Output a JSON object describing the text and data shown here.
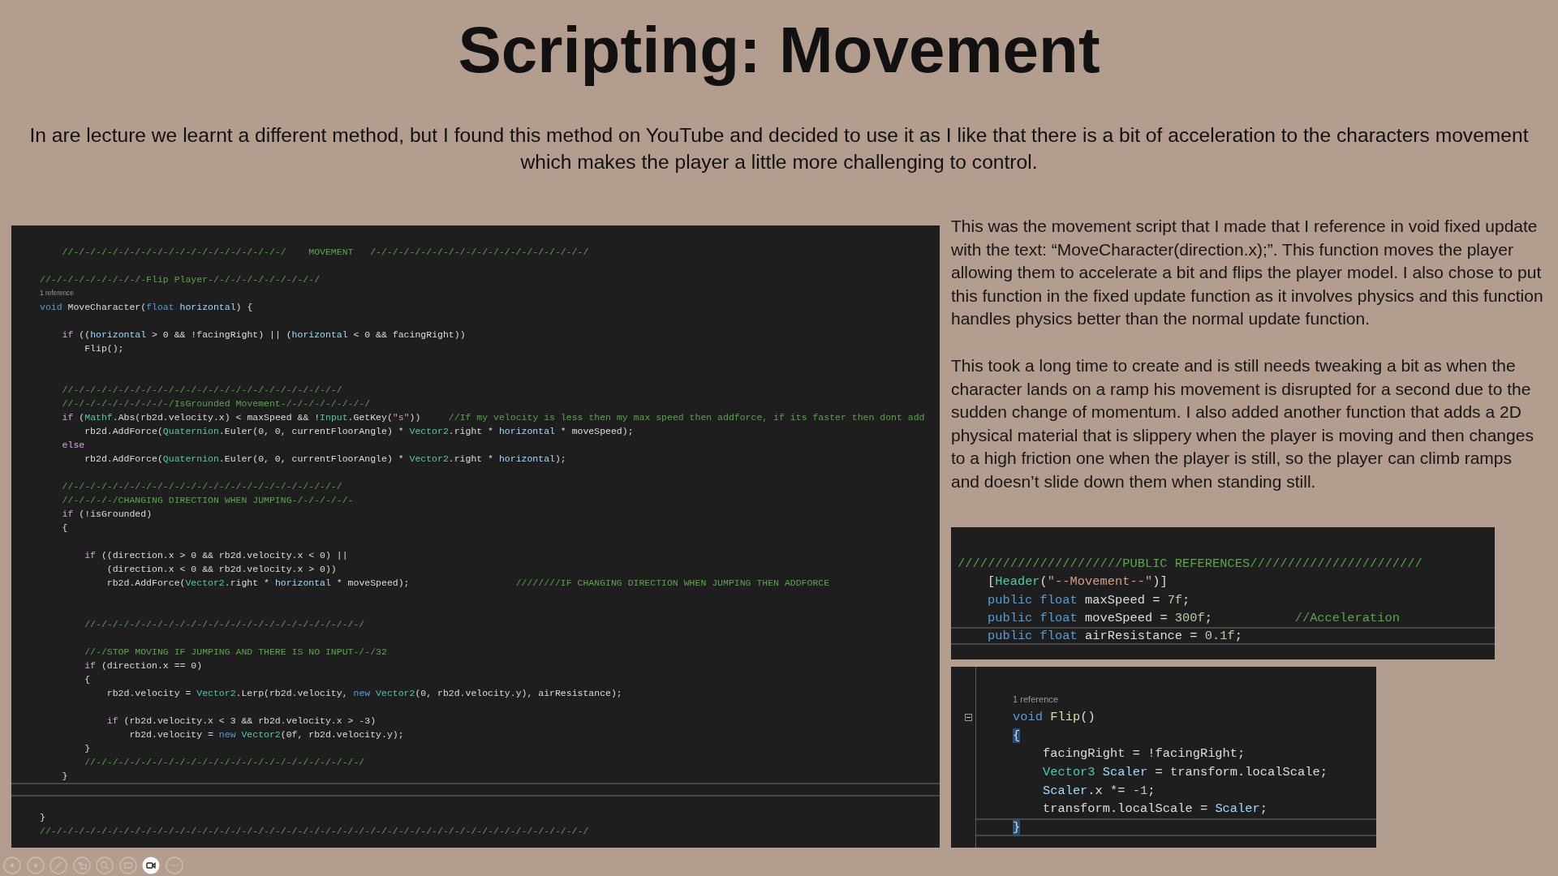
{
  "slide": {
    "title": "Scripting: Movement",
    "intro": "In are lecture we learnt a different method, but I found this method on YouTube and decided to use it as I like that there is a bit of acceleration to the characters movement which makes the player a little more challenging to control."
  },
  "code_screenshots": [
    {
      "lines": [
        {
          "kind": "code",
          "segments": [
            {
              "text": "    //-/-/-/-/-/-/-/-/-/-/-/-/-/-/-/-/-/-/-/    MOVEMENT   /-/-/-/-/-/-/-/-/-/-/-/-/-/-/-/-/-/-/-/",
              "kind": "comment"
            }
          ]
        },
        {
          "kind": "blank"
        },
        {
          "kind": "code",
          "segments": [
            {
              "text": "//-/-/-/-/-/-/-/-/-Flip Player-/-/-/-/-/-/-/-/-/-/",
              "kind": "comment"
            }
          ]
        },
        {
          "kind": "lens",
          "text": "1 reference"
        },
        {
          "kind": "code",
          "segments": [
            {
              "text": "void",
              "kind": "keyword"
            },
            {
              "text": " MoveCharacter(",
              "kind": "plain"
            },
            {
              "text": "float",
              "kind": "keyword"
            },
            {
              "text": " horizontal",
              "kind": "param"
            },
            {
              "text": ") {",
              "kind": "plain"
            }
          ]
        },
        {
          "kind": "blank"
        },
        {
          "kind": "code",
          "segments": [
            {
              "text": "    if",
              "kind": "control"
            },
            {
              "text": " ((",
              "kind": "plain"
            },
            {
              "text": "horizontal",
              "kind": "param"
            },
            {
              "text": " > 0 && !facingRight) || (",
              "kind": "plain"
            },
            {
              "text": "horizontal",
              "kind": "param"
            },
            {
              "text": " < 0 && facingRight))",
              "kind": "plain"
            }
          ]
        },
        {
          "kind": "code",
          "segments": [
            {
              "text": "        Flip();",
              "kind": "plain"
            }
          ]
        },
        {
          "kind": "blank"
        },
        {
          "kind": "blank"
        },
        {
          "kind": "code",
          "segments": [
            {
              "text": "    //-/-/-/-/-/-/-/-/-/-/-/-/-/-/-/-/-/-/-/-/-/-/-/-/",
              "kind": "comment"
            }
          ]
        },
        {
          "kind": "code",
          "segments": [
            {
              "text": "    //-/-/-/-/-/-/-/-/-/IsGrounded Movement-/-/-/-/-/-/-/-/",
              "kind": "comment"
            }
          ]
        },
        {
          "kind": "code",
          "segments": [
            {
              "text": "    if",
              "kind": "control"
            },
            {
              "text": " (",
              "kind": "plain"
            },
            {
              "text": "Mathf",
              "kind": "type"
            },
            {
              "text": ".Abs(rb2d.velocity.x) < maxSpeed && !",
              "kind": "plain"
            },
            {
              "text": "Input",
              "kind": "type"
            },
            {
              "text": ".GetKey(",
              "kind": "plain"
            },
            {
              "text": "\"s\"",
              "kind": "string"
            },
            {
              "text": "))     ",
              "kind": "plain"
            },
            {
              "text": "//If my velocity is less then my max speed then addforce, if its faster then dont add",
              "kind": "comment"
            }
          ]
        },
        {
          "kind": "code",
          "segments": [
            {
              "text": "        rb2d.AddForce(",
              "kind": "plain"
            },
            {
              "text": "Quaternion",
              "kind": "type"
            },
            {
              "text": ".Euler(0, 0, currentFloorAngle) * ",
              "kind": "plain"
            },
            {
              "text": "Vector2",
              "kind": "type"
            },
            {
              "text": ".right * ",
              "kind": "plain"
            },
            {
              "text": "horizontal",
              "kind": "param"
            },
            {
              "text": " * moveSpeed);",
              "kind": "plain"
            }
          ]
        },
        {
          "kind": "code",
          "segments": [
            {
              "text": "    else",
              "kind": "control"
            }
          ]
        },
        {
          "kind": "code",
          "segments": [
            {
              "text": "        rb2d.AddForce(",
              "kind": "plain"
            },
            {
              "text": "Quaternion",
              "kind": "type"
            },
            {
              "text": ".Euler(0, 0, currentFloorAngle) * ",
              "kind": "plain"
            },
            {
              "text": "Vector2",
              "kind": "type"
            },
            {
              "text": ".right * ",
              "kind": "plain"
            },
            {
              "text": "horizontal",
              "kind": "param"
            },
            {
              "text": ");",
              "kind": "plain"
            }
          ]
        },
        {
          "kind": "blank"
        },
        {
          "kind": "code",
          "segments": [
            {
              "text": "    //-/-/-/-/-/-/-/-/-/-/-/-/-/-/-/-/-/-/-/-/-/-/-/-/",
              "kind": "comment"
            }
          ]
        },
        {
          "kind": "code",
          "segments": [
            {
              "text": "    //-/-/-/-/CHANGING DIRECTION WHEN JUMPING-/-/-/-/-/-",
              "kind": "comment"
            }
          ]
        },
        {
          "kind": "code",
          "segments": [
            {
              "text": "    if",
              "kind": "control"
            },
            {
              "text": " (!isGrounded)",
              "kind": "plain"
            }
          ]
        },
        {
          "kind": "code",
          "segments": [
            {
              "text": "    {",
              "kind": "plain"
            }
          ]
        },
        {
          "kind": "blank"
        },
        {
          "kind": "code",
          "segments": [
            {
              "text": "        if",
              "kind": "control"
            },
            {
              "text": " ((direction.x > 0 && rb2d.velocity.x < 0) ||",
              "kind": "plain"
            }
          ]
        },
        {
          "kind": "code",
          "segments": [
            {
              "text": "            (direction.x < 0 && rb2d.velocity.x > 0))",
              "kind": "plain"
            }
          ]
        },
        {
          "kind": "code",
          "segments": [
            {
              "text": "            rb2d.AddForce(",
              "kind": "plain"
            },
            {
              "text": "Vector2",
              "kind": "type"
            },
            {
              "text": ".right * ",
              "kind": "plain"
            },
            {
              "text": "horizontal",
              "kind": "param"
            },
            {
              "text": " * moveSpeed);                   ",
              "kind": "plain"
            },
            {
              "text": "////////IF CHANGING DIRECTION WHEN JUMPING THEN ADDFORCE",
              "kind": "comment"
            }
          ]
        },
        {
          "kind": "blank"
        },
        {
          "kind": "blank"
        },
        {
          "kind": "code",
          "segments": [
            {
              "text": "        //-/-/-/-/-/-/-/-/-/-/-/-/-/-/-/-/-/-/-/-/-/-/-/-/",
              "kind": "comment"
            }
          ]
        },
        {
          "kind": "blank"
        },
        {
          "kind": "code",
          "segments": [
            {
              "text": "        //-/STOP MOVING IF JUMPING AND THERE IS NO INPUT-/-/32",
              "kind": "comment"
            }
          ]
        },
        {
          "kind": "code",
          "segments": [
            {
              "text": "        if",
              "kind": "control"
            },
            {
              "text": " (direction.x == 0)",
              "kind": "plain"
            }
          ]
        },
        {
          "kind": "code",
          "segments": [
            {
              "text": "        {",
              "kind": "plain"
            }
          ]
        },
        {
          "kind": "code",
          "segments": [
            {
              "text": "            rb2d.velocity = ",
              "kind": "plain"
            },
            {
              "text": "Vector2",
              "kind": "type"
            },
            {
              "text": ".Lerp(rb2d.velocity, ",
              "kind": "plain"
            },
            {
              "text": "new ",
              "kind": "keyword"
            },
            {
              "text": "Vector2",
              "kind": "type"
            },
            {
              "text": "(0, rb2d.velocity.y), airResistance);",
              "kind": "plain"
            }
          ]
        },
        {
          "kind": "blank"
        },
        {
          "kind": "code",
          "segments": [
            {
              "text": "            if",
              "kind": "control"
            },
            {
              "text": " (rb2d.velocity.x < 3 && rb2d.velocity.x > -3)",
              "kind": "plain"
            }
          ]
        },
        {
          "kind": "code",
          "segments": [
            {
              "text": "                rb2d.velocity = ",
              "kind": "plain"
            },
            {
              "text": "new ",
              "kind": "keyword"
            },
            {
              "text": "Vector2",
              "kind": "type"
            },
            {
              "text": "(0f, rb2d.velocity.y);",
              "kind": "plain"
            }
          ]
        },
        {
          "kind": "code",
          "segments": [
            {
              "text": "        }",
              "kind": "plain"
            }
          ]
        },
        {
          "kind": "code",
          "segments": [
            {
              "text": "        //-/-/-/-/-/-/-/-/-/-/-/-/-/-/-/-/-/-/-/-/-/-/-/-/",
              "kind": "comment"
            }
          ]
        },
        {
          "kind": "code",
          "segments": [
            {
              "text": "    }",
              "kind": "plain"
            }
          ]
        },
        {
          "kind": "blank",
          "current": true
        },
        {
          "kind": "blank"
        },
        {
          "kind": "code",
          "segments": [
            {
              "text": "}",
              "kind": "plain"
            }
          ]
        },
        {
          "kind": "code",
          "segments": [
            {
              "text": "//-/-/-/-/-/-/-/-/-/-/-/-/-/-/-/-/-/-/-/-/-/-/-/-/-/-/-/-/-/-/-/-/-/-/-/-/-/-/-/-/-/-/-/-/-/-/-/-/",
              "kind": "comment"
            }
          ]
        }
      ]
    },
    {
      "lines": [
        {
          "kind": "blank"
        },
        {
          "kind": "code",
          "segments": [
            {
              "text": "//////////////////////PUBLIC REFERENCES///////////////////////",
              "kind": "comment"
            }
          ]
        },
        {
          "kind": "code",
          "segments": [
            {
              "text": "    [",
              "kind": "plain"
            },
            {
              "text": "Header",
              "kind": "type"
            },
            {
              "text": "(",
              "kind": "plain"
            },
            {
              "text": "\"--Movement--\"",
              "kind": "string"
            },
            {
              "text": ")]",
              "kind": "plain"
            }
          ]
        },
        {
          "kind": "code",
          "segments": [
            {
              "text": "    public float",
              "kind": "keyword"
            },
            {
              "text": " maxSpeed = ",
              "kind": "plain"
            },
            {
              "text": "7f",
              "kind": "number"
            },
            {
              "text": ";",
              "kind": "plain"
            }
          ]
        },
        {
          "kind": "code",
          "segments": [
            {
              "text": "    public float",
              "kind": "keyword"
            },
            {
              "text": " moveSpeed = ",
              "kind": "plain"
            },
            {
              "text": "300f",
              "kind": "number"
            },
            {
              "text": ";           ",
              "kind": "plain"
            },
            {
              "text": "//Acceleration",
              "kind": "comment"
            }
          ]
        },
        {
          "kind": "code",
          "current": true,
          "segments": [
            {
              "text": "    public float",
              "kind": "keyword"
            },
            {
              "text": " airResistance = ",
              "kind": "plain"
            },
            {
              "text": "0.1f",
              "kind": "number"
            },
            {
              "text": ";",
              "kind": "plain"
            }
          ]
        }
      ]
    },
    {
      "lines": [
        {
          "kind": "blank"
        },
        {
          "kind": "lens",
          "text": "1 reference"
        },
        {
          "kind": "code",
          "fold": true,
          "segments": [
            {
              "text": "void ",
              "kind": "keyword"
            },
            {
              "text": "Flip",
              "kind": "method"
            },
            {
              "text": "()",
              "kind": "plain"
            }
          ]
        },
        {
          "kind": "code",
          "segments": [
            {
              "text": "{",
              "kind": "brace"
            }
          ]
        },
        {
          "kind": "code",
          "segments": [
            {
              "text": "    facingRight = !facingRight;",
              "kind": "plain"
            }
          ]
        },
        {
          "kind": "code",
          "segments": [
            {
              "text": "    Vector3 ",
              "kind": "type"
            },
            {
              "text": "Scaler",
              "kind": "param"
            },
            {
              "text": " = transform.localScale;",
              "kind": "plain"
            }
          ]
        },
        {
          "kind": "code",
          "segments": [
            {
              "text": "    Scaler",
              "kind": "param"
            },
            {
              "text": ".x *= ",
              "kind": "plain"
            },
            {
              "text": "-1",
              "kind": "number"
            },
            {
              "text": ";",
              "kind": "plain"
            }
          ]
        },
        {
          "kind": "code",
          "segments": [
            {
              "text": "    transform.localScale = ",
              "kind": "plain"
            },
            {
              "text": "Scaler",
              "kind": "param"
            },
            {
              "text": ";",
              "kind": "plain"
            }
          ]
        },
        {
          "kind": "code",
          "current": true,
          "segments": [
            {
              "text": "}",
              "kind": "brace"
            }
          ]
        }
      ]
    }
  ],
  "description": [
    "This was the movement script that I made that I reference in void fixed update with the text: “MoveCharacter(direction.x);”. This function moves the player allowing them to accelerate a bit and flips the player model. I also chose to put this function in the fixed update function as it involves physics and this function handles physics better than the normal update function.",
    "This took a long time to create and is still needs tweaking a bit as when the character lands on a ramp his movement is disrupted for a second due to the sudden change of momentum. I also added another function that adds a 2D physical material that is slippery when the player is moving and then changes to a high friction one when the player is still, so the player can climb ramps and doesn’t slide down them when standing still."
  ]
}
